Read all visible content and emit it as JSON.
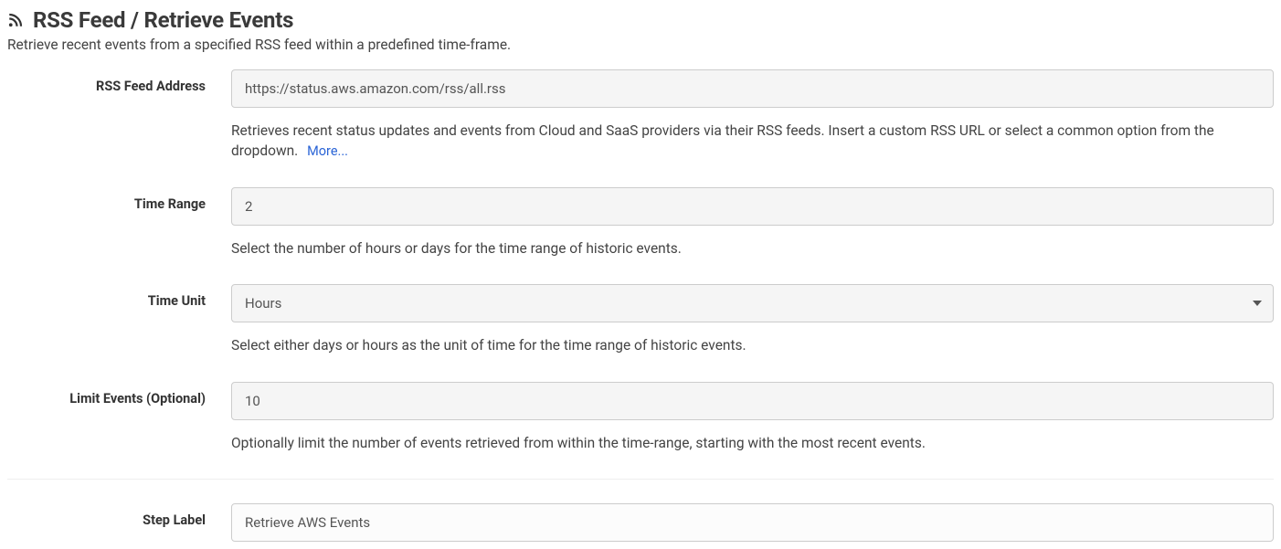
{
  "header": {
    "title": "RSS Feed / Retrieve Events",
    "subtitle": "Retrieve recent events from a specified RSS feed within a predefined time-frame."
  },
  "fields": {
    "rss": {
      "label": "RSS Feed Address",
      "value": "https://status.aws.amazon.com/rss/all.rss",
      "select_value": "https://status.aws.amazon.com/rss/all.rss",
      "help": "Retrieves recent status updates and events from Cloud and SaaS providers via their RSS feeds. Insert a custom RSS URL or select a common option from the dropdown.",
      "more_label": "More..."
    },
    "time_range": {
      "label": "Time Range",
      "value": "2",
      "help": "Select the number of hours or days for the time range of historic events."
    },
    "time_unit": {
      "label": "Time Unit",
      "value": "Hours",
      "help": "Select either days or hours as the unit of time for the time range of historic events."
    },
    "limit": {
      "label": "Limit Events (Optional)",
      "value": "10",
      "help": "Optionally limit the number of events retrieved from within the time-range, starting with the most recent events."
    },
    "step_label": {
      "label": "Step Label",
      "value": "Retrieve AWS Events"
    }
  }
}
